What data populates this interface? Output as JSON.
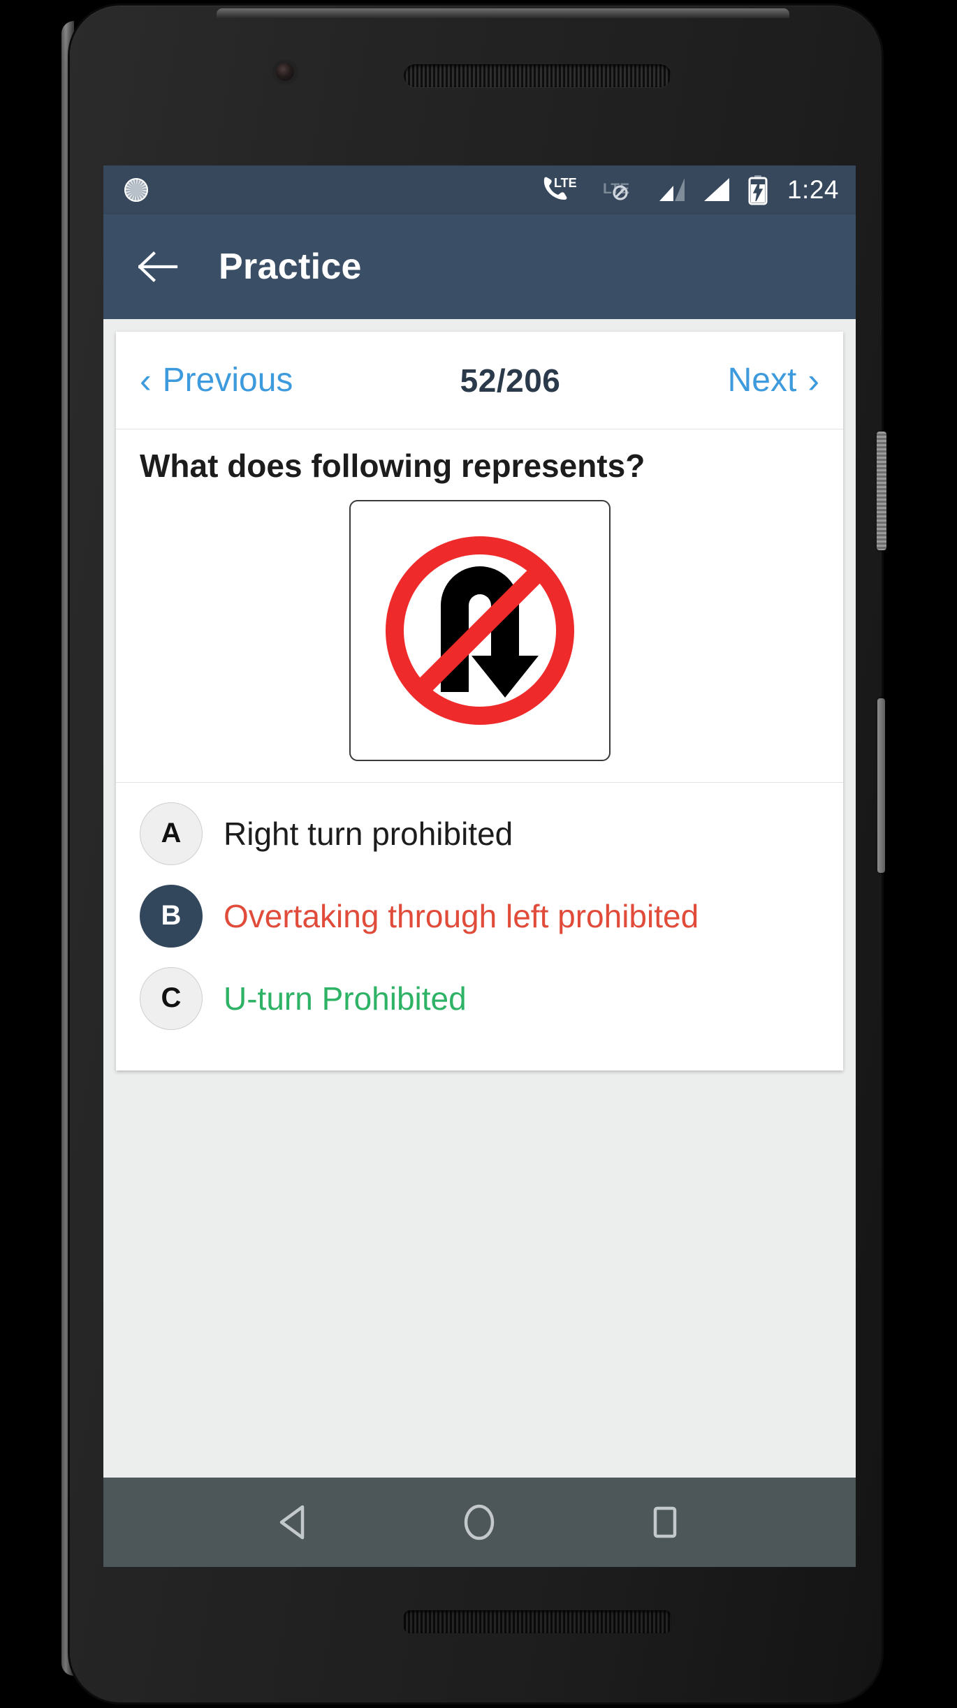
{
  "device": {
    "frame_color": "#242424",
    "front_camera_label": "front-camera",
    "earpiece_label": "earpiece-speaker"
  },
  "status_bar": {
    "background": "#37485c",
    "clock": "1:24",
    "icons": [
      {
        "name": "app-notification-icon",
        "label": ""
      },
      {
        "name": "phone-lte-icon",
        "label": "LTE"
      },
      {
        "name": "lte-disabled-icon",
        "label": "LTE"
      },
      {
        "name": "signal-bars-sim1-icon",
        "label": ""
      },
      {
        "name": "signal-bars-sim2-icon",
        "label": ""
      },
      {
        "name": "battery-charging-icon",
        "label": ""
      }
    ]
  },
  "app_bar": {
    "background": "#3a4f66",
    "back_icon": "arrow-left-icon",
    "title": "Practice"
  },
  "quiz": {
    "nav": {
      "previous_label": "Previous",
      "previous_chevron": "‹",
      "next_label": "Next",
      "next_chevron": "›",
      "counter": "52/206",
      "current_index": 52,
      "total": 206,
      "link_color": "#3d9bdd",
      "counter_color": "#2b3a4a"
    },
    "question": {
      "text": "What does following represents?",
      "image": {
        "name": "no-u-turn-sign",
        "description": "No U-turn road sign: red circle with diagonal slash over a black U-turn arrow pointing down",
        "ring_color": "#ee2a2a",
        "arrow_color": "#000000",
        "background": "#ffffff"
      }
    },
    "options": [
      {
        "letter": "A",
        "text": "Right turn prohibited",
        "state": "unselected",
        "badge_style": "plain",
        "text_color": "#1c1c1c"
      },
      {
        "letter": "B",
        "text": "Overtaking through left prohibited",
        "state": "selected-incorrect",
        "badge_style": "selected",
        "text_color": "#e04b3a"
      },
      {
        "letter": "C",
        "text": "U-turn Prohibited",
        "state": "correct",
        "badge_style": "plain",
        "text_color": "#2eb265"
      }
    ]
  },
  "system_nav": {
    "background": "#4d5659",
    "buttons": [
      {
        "name": "nav-back-button",
        "icon": "triangle-left-icon"
      },
      {
        "name": "nav-home-button",
        "icon": "circle-icon"
      },
      {
        "name": "nav-recents-button",
        "icon": "square-icon"
      }
    ]
  }
}
